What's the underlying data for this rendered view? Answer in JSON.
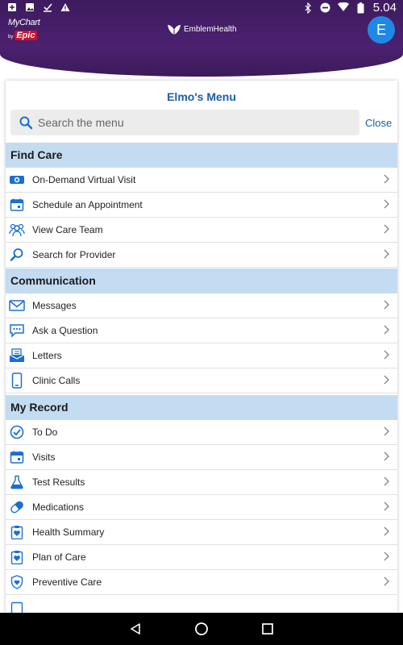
{
  "status_bar": {
    "time": "5.04",
    "battery_level": 0.85
  },
  "header": {
    "mychart_text": "MyChart",
    "mychart_by": "by",
    "mychart_epic": "Epic",
    "brand_name": "EmblemHealth",
    "avatar_initial": "E",
    "colors": {
      "background": "#3d1b5e",
      "avatar": "#1e88e5"
    }
  },
  "menu": {
    "title": "Elmo's Menu",
    "search": {
      "placeholder": "Search the menu",
      "value": ""
    },
    "close_label": "Close",
    "sections": [
      {
        "title": "Find Care",
        "items": [
          {
            "label": "On-Demand Virtual Visit",
            "icon": "video-visit-icon"
          },
          {
            "label": "Schedule an Appointment",
            "icon": "calendar-icon"
          },
          {
            "label": "View Care Team",
            "icon": "care-team-icon"
          },
          {
            "label": "Search for Provider",
            "icon": "magnifier-icon"
          }
        ]
      },
      {
        "title": "Communication",
        "items": [
          {
            "label": "Messages",
            "icon": "envelope-icon"
          },
          {
            "label": "Ask a Question",
            "icon": "chat-bubble-icon"
          },
          {
            "label": "Letters",
            "icon": "letter-icon"
          },
          {
            "label": "Clinic Calls",
            "icon": "phone-icon"
          }
        ]
      },
      {
        "title": "My Record",
        "items": [
          {
            "label": "To Do",
            "icon": "checkmark-icon"
          },
          {
            "label": "Visits",
            "icon": "calendar-icon"
          },
          {
            "label": "Test Results",
            "icon": "flask-icon"
          },
          {
            "label": "Medications",
            "icon": "pill-icon"
          },
          {
            "label": "Health Summary",
            "icon": "clipboard-heart-icon"
          },
          {
            "label": "Plan of Care",
            "icon": "clipboard-heart-icon"
          },
          {
            "label": "Preventive Care",
            "icon": "shield-heart-icon"
          }
        ]
      }
    ]
  },
  "colors": {
    "accent": "#1a5ea8",
    "section_bg": "#c4dcf2",
    "icon_blue": "#1a6fd1"
  }
}
